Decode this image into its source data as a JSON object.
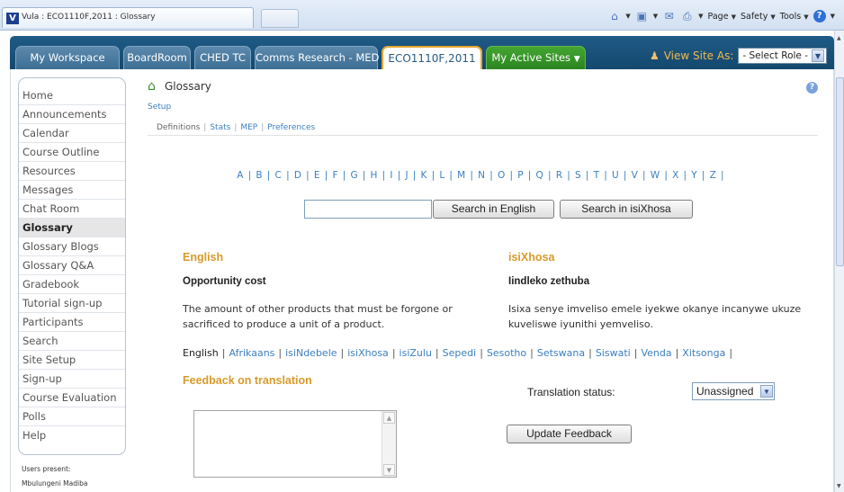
{
  "browser": {
    "tab_title": "Vula : ECO1110F,2011 : Glossary",
    "favicon_letter": "V",
    "toolbar": {
      "page_label": "Page",
      "safety_label": "Safety",
      "tools_label": "Tools"
    }
  },
  "site_nav": {
    "tabs": [
      {
        "label": "My Workspace"
      },
      {
        "label": "BoardRoom"
      },
      {
        "label": "CHED TC"
      },
      {
        "label": "Comms Research - MED"
      },
      {
        "label": "ECO1110F,2011"
      },
      {
        "label": "My Active Sites"
      }
    ],
    "view_site_as_label": "View Site As:",
    "role_select_value": "- Select Role -"
  },
  "left_nav": {
    "items": [
      {
        "label": "Home"
      },
      {
        "label": "Announcements"
      },
      {
        "label": "Calendar"
      },
      {
        "label": "Course Outline"
      },
      {
        "label": "Resources"
      },
      {
        "label": "Messages"
      },
      {
        "label": "Chat Room"
      },
      {
        "label": "Glossary"
      },
      {
        "label": "Glossary Blogs"
      },
      {
        "label": "Glossary Q&A"
      },
      {
        "label": "Gradebook"
      },
      {
        "label": "Tutorial sign-up"
      },
      {
        "label": "Participants"
      },
      {
        "label": "Search"
      },
      {
        "label": "Site Setup"
      },
      {
        "label": "Sign-up"
      },
      {
        "label": "Course Evaluation"
      },
      {
        "label": "Polls"
      },
      {
        "label": "Help"
      }
    ],
    "users_present_label": "Users present:",
    "users_present": "Mbulungeni Madiba"
  },
  "tool": {
    "title": "Glossary",
    "setup_link": "Setup",
    "subnav": [
      "Definitions",
      "Stats",
      "MEP",
      "Preferences"
    ]
  },
  "alphabet": [
    "A",
    "B",
    "C",
    "D",
    "E",
    "F",
    "G",
    "H",
    "I",
    "J",
    "K",
    "L",
    "M",
    "N",
    "O",
    "P",
    "Q",
    "R",
    "S",
    "T",
    "U",
    "V",
    "W",
    "X",
    "Y",
    "Z"
  ],
  "search": {
    "input_value": "",
    "btn_english": "Search in English",
    "btn_xhosa": "Search in isiXhosa"
  },
  "entry": {
    "english_heading": "English",
    "xhosa_heading": "isiXhosa",
    "english_term": "Opportunity cost",
    "xhosa_term": "Iindleko zethuba",
    "english_definition": "The amount of other products that must be forgone or sacrificed to produce a unit of a product.",
    "xhosa_definition": "Isixa senye imveliso emele iyekwe okanye incanywe ukuze kuveliswe iyunithi yemveliso."
  },
  "languages": {
    "current": "English",
    "links": [
      "Afrikaans",
      "isiNdebele",
      "isiXhosa",
      "isiZulu",
      "Sepedi",
      "Sesotho",
      "Setswana",
      "Siswati",
      "Venda",
      "Xitsonga"
    ]
  },
  "feedback": {
    "heading": "Feedback on translation",
    "status_label": "Translation status:",
    "status_value": "Unassigned",
    "textarea_value": "",
    "update_button": "Update Feedback"
  },
  "colors": {
    "nav_bar": "#1f5b86",
    "current_tab_border": "#e8a52f",
    "active_sites_tab": "#43a531",
    "heading_orange": "#d89a2a",
    "link_blue": "#3c7fc0"
  }
}
